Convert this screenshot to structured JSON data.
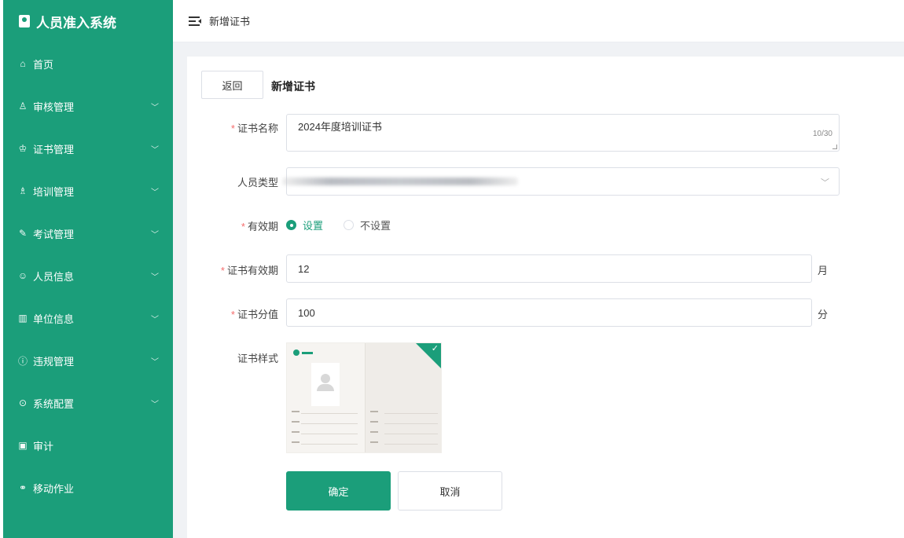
{
  "app": {
    "title": "人员准入系统"
  },
  "sidebar": {
    "items": [
      {
        "label": "首页",
        "icon": "home-icon",
        "glyph": "⌂",
        "expandable": false
      },
      {
        "label": "审核管理",
        "icon": "stamp-icon",
        "glyph": "♙",
        "expandable": true
      },
      {
        "label": "证书管理",
        "icon": "certificate-icon",
        "glyph": "♔",
        "expandable": true
      },
      {
        "label": "培训管理",
        "icon": "training-icon",
        "glyph": "♗",
        "expandable": true
      },
      {
        "label": "考试管理",
        "icon": "edit-icon",
        "glyph": "✎",
        "expandable": true
      },
      {
        "label": "人员信息",
        "icon": "user-circle-icon",
        "glyph": "☺",
        "expandable": true
      },
      {
        "label": "单位信息",
        "icon": "building-icon",
        "glyph": "▥",
        "expandable": true
      },
      {
        "label": "违规管理",
        "icon": "warning-icon",
        "glyph": "ⓘ",
        "expandable": true
      },
      {
        "label": "系统配置",
        "icon": "settings-icon",
        "glyph": "⊙",
        "expandable": true
      },
      {
        "label": "审计",
        "icon": "audit-icon",
        "glyph": "▣",
        "expandable": false
      },
      {
        "label": "移动作业",
        "icon": "link-icon",
        "glyph": "⚭",
        "expandable": false
      }
    ],
    "chevron": "﹀"
  },
  "header": {
    "breadcrumb": "新增证书"
  },
  "page": {
    "back_label": "返回",
    "title": "新增证书"
  },
  "form": {
    "cert_name": {
      "label": "证书名称",
      "required": "*",
      "value": "2024年度培训证书",
      "counter": "10/30"
    },
    "person_type": {
      "label": "人员类型",
      "value": ""
    },
    "validity": {
      "label": "有效期",
      "required": "*",
      "options": [
        "设置",
        "不设置"
      ],
      "selected": "设置"
    },
    "validity_period": {
      "label": "证书有效期",
      "required": "*",
      "value": "12",
      "unit": "月"
    },
    "score": {
      "label": "证书分值",
      "required": "*",
      "value": "100",
      "unit": "分"
    },
    "style": {
      "label": "证书样式",
      "check": "✓"
    },
    "confirm_label": "确定",
    "cancel_label": "取消"
  },
  "colors": {
    "primary": "#1b9e7a",
    "required": "#f56c6c",
    "background": "#f0f2f5"
  }
}
